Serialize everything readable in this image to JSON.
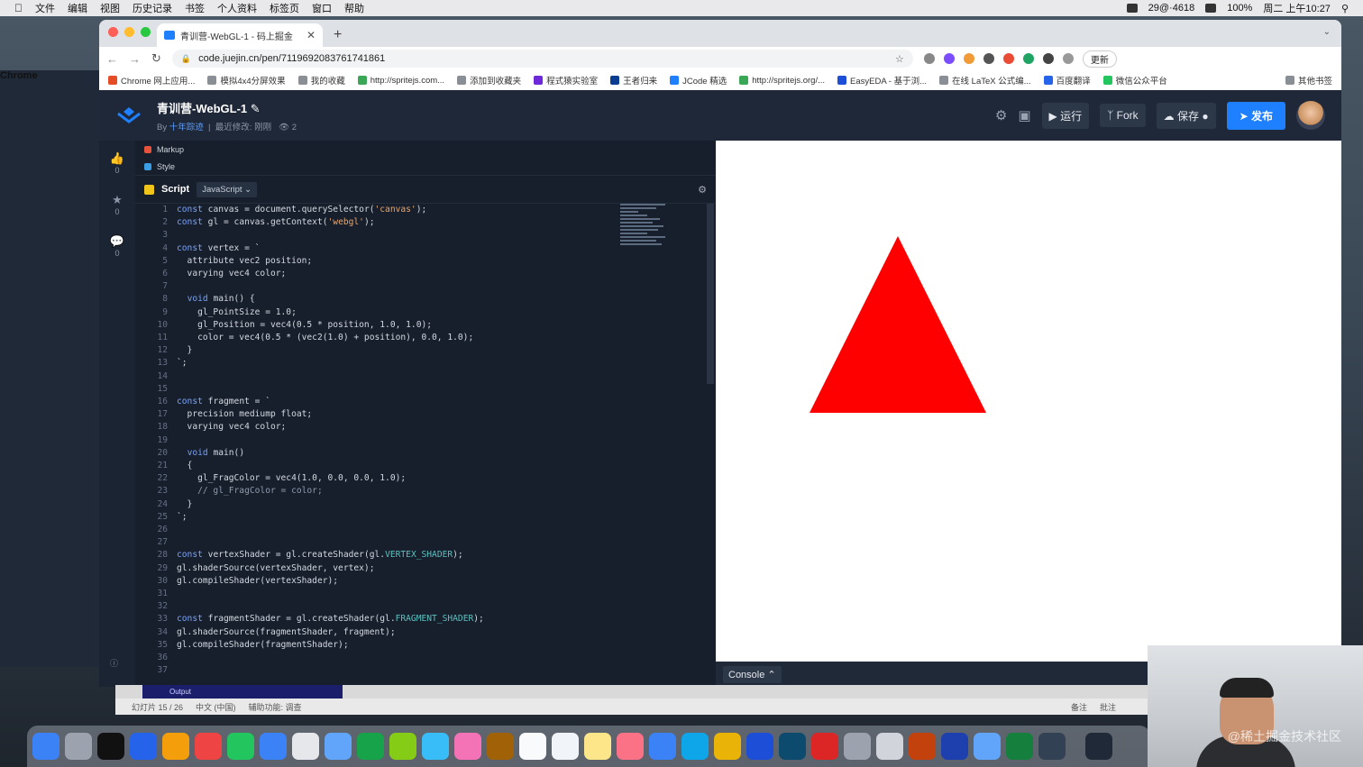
{
  "menubar": {
    "app_name": "Chrome",
    "menus": [
      "文件",
      "编辑",
      "视图",
      "历史记录",
      "书签",
      "个人资料",
      "标签页",
      "窗口",
      "帮助"
    ],
    "status": "29@·4618",
    "battery": "100%",
    "datetime": "周二 上午10:27"
  },
  "browser": {
    "tab_title": "青训营-WebGL-1 - 码上掘金",
    "url": "code.juejin.cn/pen/7119692083761741861",
    "update_label": "更新",
    "bookmarks": [
      "Chrome 网上应用...",
      "模拟4x4分屏效果",
      "我的收藏",
      "http://spritejs.com...",
      "添加到收藏夹",
      "程式猿实验室",
      "王者归来",
      "JCode 精选",
      "http://spritejs.org/...",
      "EasyEDA - 基于浏...",
      "在线 LaTeX 公式编...",
      "百度翻译",
      "微信公众平台"
    ],
    "other_bookmarks": "其他书签"
  },
  "project": {
    "title": "青训营-WebGL-1",
    "by": "By",
    "author": "十年踪迹",
    "modified_label": "最近修改",
    "modified_value": "刚刚",
    "views": "2",
    "run_label": "运行",
    "fork_label": "Fork",
    "save_label": "保存",
    "publish_label": "发布"
  },
  "leftbar": {
    "like_count": "0",
    "star_count": "0",
    "comment_count": "0"
  },
  "editor": {
    "markup_label": "Markup",
    "style_label": "Style",
    "script_label": "Script",
    "language": "JavaScript",
    "lines": [
      "const canvas = document.querySelector('canvas');",
      "const gl = canvas.getContext('webgl');",
      "",
      "const vertex = `",
      "  attribute vec2 position;",
      "  varying vec4 color;",
      "",
      "  void main() {",
      "    gl_PointSize = 1.0;",
      "    gl_Position = vec4(0.5 * position, 1.0, 1.0);",
      "    color = vec4(0.5 * (vec2(1.0) + position), 0.0, 1.0);",
      "  }",
      "`;",
      "",
      "",
      "const fragment = `",
      "  precision mediump float;",
      "  varying vec4 color;",
      "",
      "  void main()",
      "  {",
      "    gl_FragColor = vec4(1.0, 0.0, 0.0, 1.0);",
      "    // gl_FragColor = color;",
      "  }",
      "`;",
      "",
      "",
      "const vertexShader = gl.createShader(gl.VERTEX_SHADER);",
      "gl.shaderSource(vertexShader, vertex);",
      "gl.compileShader(vertexShader);",
      "",
      "",
      "const fragmentShader = gl.createShader(gl.FRAGMENT_SHADER);",
      "gl.shaderSource(fragmentShader, fragment);",
      "gl.compileShader(fragmentShader);",
      "",
      ""
    ]
  },
  "preview": {
    "shape_color": "#ff0000"
  },
  "console_label": "Console",
  "ppt": {
    "output_label": "Output",
    "slide_info": "幻灯片 15 / 26",
    "language": "中文 (中国)",
    "accessibility": "辅助功能: 调查",
    "notes": "备注",
    "comments": "批注"
  },
  "watermark": "@稀土掘金技术社区"
}
